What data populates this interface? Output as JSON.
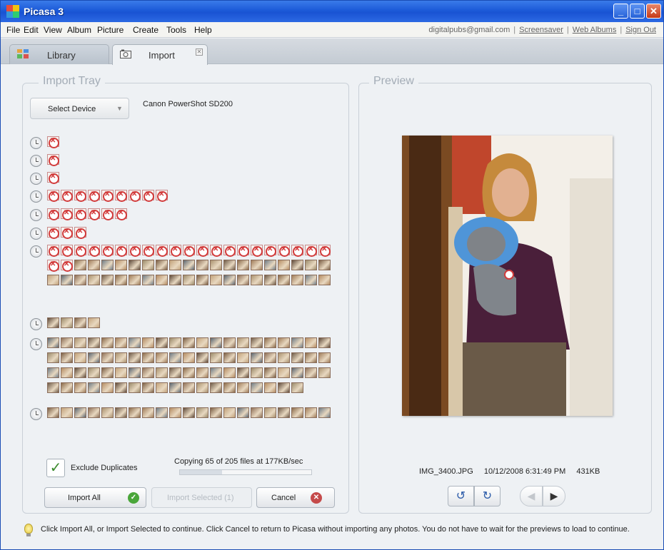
{
  "window": {
    "title": "Picasa 3",
    "controls": {
      "minimize": "_",
      "maximize": "□",
      "close": "✕"
    }
  },
  "menu": [
    "File",
    "Edit",
    "View",
    "Album",
    "Picture",
    "Create",
    "Tools",
    "Help"
  ],
  "account": {
    "email": "digitalpubs@gmail.com",
    "screensaver": "Screensaver",
    "web_albums": "Web Albums",
    "sign_out": "Sign Out",
    "separator": "|"
  },
  "tabs": [
    {
      "label": "Library",
      "icon": "library-grid-icon"
    },
    {
      "label": "Import",
      "icon": "camera-icon"
    }
  ],
  "import_tray": {
    "title": "Import Tray",
    "select_device": "Select Device",
    "device_name": "Canon PowerShot SD200",
    "groups": [
      {
        "thumbnail_count": 1,
        "loaded": 0
      },
      {
        "thumbnail_count": 1,
        "loaded": 0
      },
      {
        "thumbnail_count": 1,
        "loaded": 0
      },
      {
        "thumbnail_count": 9,
        "loaded": 0
      },
      {
        "thumbnail_count": 6,
        "loaded": 0
      },
      {
        "thumbnail_count": 3,
        "loaded": 0
      },
      {
        "thumbnail_count": 63,
        "loaded": 40
      },
      {
        "thumbnail_count": 4,
        "loaded": 4
      },
      {
        "thumbnail_count": 82,
        "loaded": 82
      },
      {
        "thumbnail_count": 21,
        "loaded": 21
      }
    ],
    "exclude_duplicates": "Exclude Duplicates",
    "exclude_checked": true,
    "progress_text": "Copying 65 of 205 files at 177KB/sec",
    "progress_fraction": 0.32,
    "import_all": "Import All",
    "import_selected": "Import Selected (1)",
    "cancel": "Cancel"
  },
  "preview": {
    "title": "Preview",
    "filename": "IMG_3400.JPG",
    "datetime": "10/12/2008 6:31:49 PM",
    "filesize": "431KB"
  },
  "hint": "Click Import All, or Import Selected to continue. Click Cancel to return to Picasa without importing any photos. You do not have to wait for the previews to load to continue.",
  "colors": {
    "titlebar": "#1c5ad8",
    "panel_bg": "#eef1f4",
    "missing_mark": "#d23b3b",
    "ok_green": "#4aa63a"
  }
}
